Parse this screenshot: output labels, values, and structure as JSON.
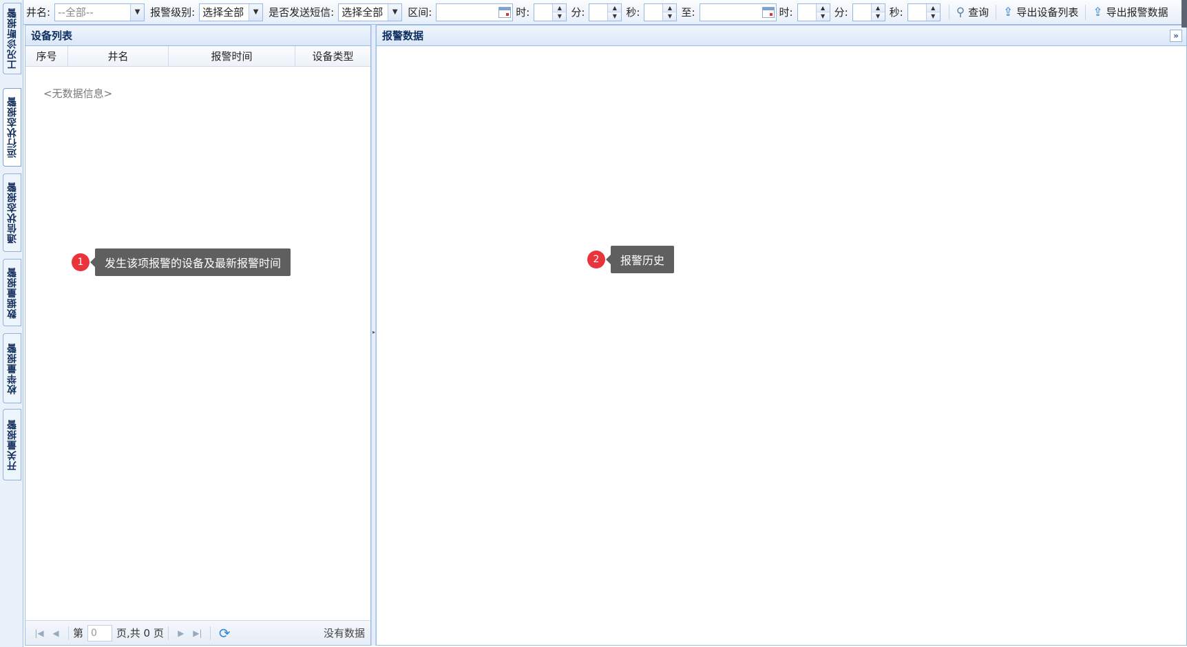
{
  "side_tabs": [
    {
      "label": "工况诊断报警",
      "active": false
    },
    {
      "label": "运行状态报警",
      "active": true
    },
    {
      "label": "通信状态报警",
      "active": false
    },
    {
      "label": "数据量报警",
      "active": false
    },
    {
      "label": "枚举量报警",
      "active": false
    },
    {
      "label": "开关量报警",
      "active": false
    }
  ],
  "toolbar": {
    "well_label": "井名:",
    "well_placeholder": "--全部--",
    "level_label": "报警级别:",
    "level_value": "选择全部",
    "sms_label": "是否发送短信:",
    "sms_value": "选择全部",
    "range_label": "区间:",
    "hour_label": "时:",
    "minute_label": "分:",
    "second_label": "秒:",
    "to_label": "至:",
    "hour_label2": "时:",
    "minute_label2": "分:",
    "second_label2": "秒:",
    "query_label": "查询",
    "export_devices_label": "导出设备列表",
    "export_alarms_label": "导出报警数据"
  },
  "left_panel": {
    "title": "设备列表",
    "columns": [
      "序号",
      "井名",
      "报警时间",
      "设备类型"
    ],
    "empty_text": "<无数据信息>",
    "pager": {
      "page_prefix": "第",
      "page_value": "0",
      "page_suffix": "页,共 0 页",
      "status": "没有数据"
    }
  },
  "right_panel": {
    "title": "报警数据"
  },
  "callouts": [
    {
      "number": "1",
      "text": "发生该项报警的设备及最新报警时间"
    },
    {
      "number": "2",
      "text": "报警历史"
    }
  ],
  "colors": {
    "border": "#99bbe8",
    "header_text": "#0e2d5f",
    "badge": "#e8343a",
    "tooltip": "#5f5f5f"
  }
}
